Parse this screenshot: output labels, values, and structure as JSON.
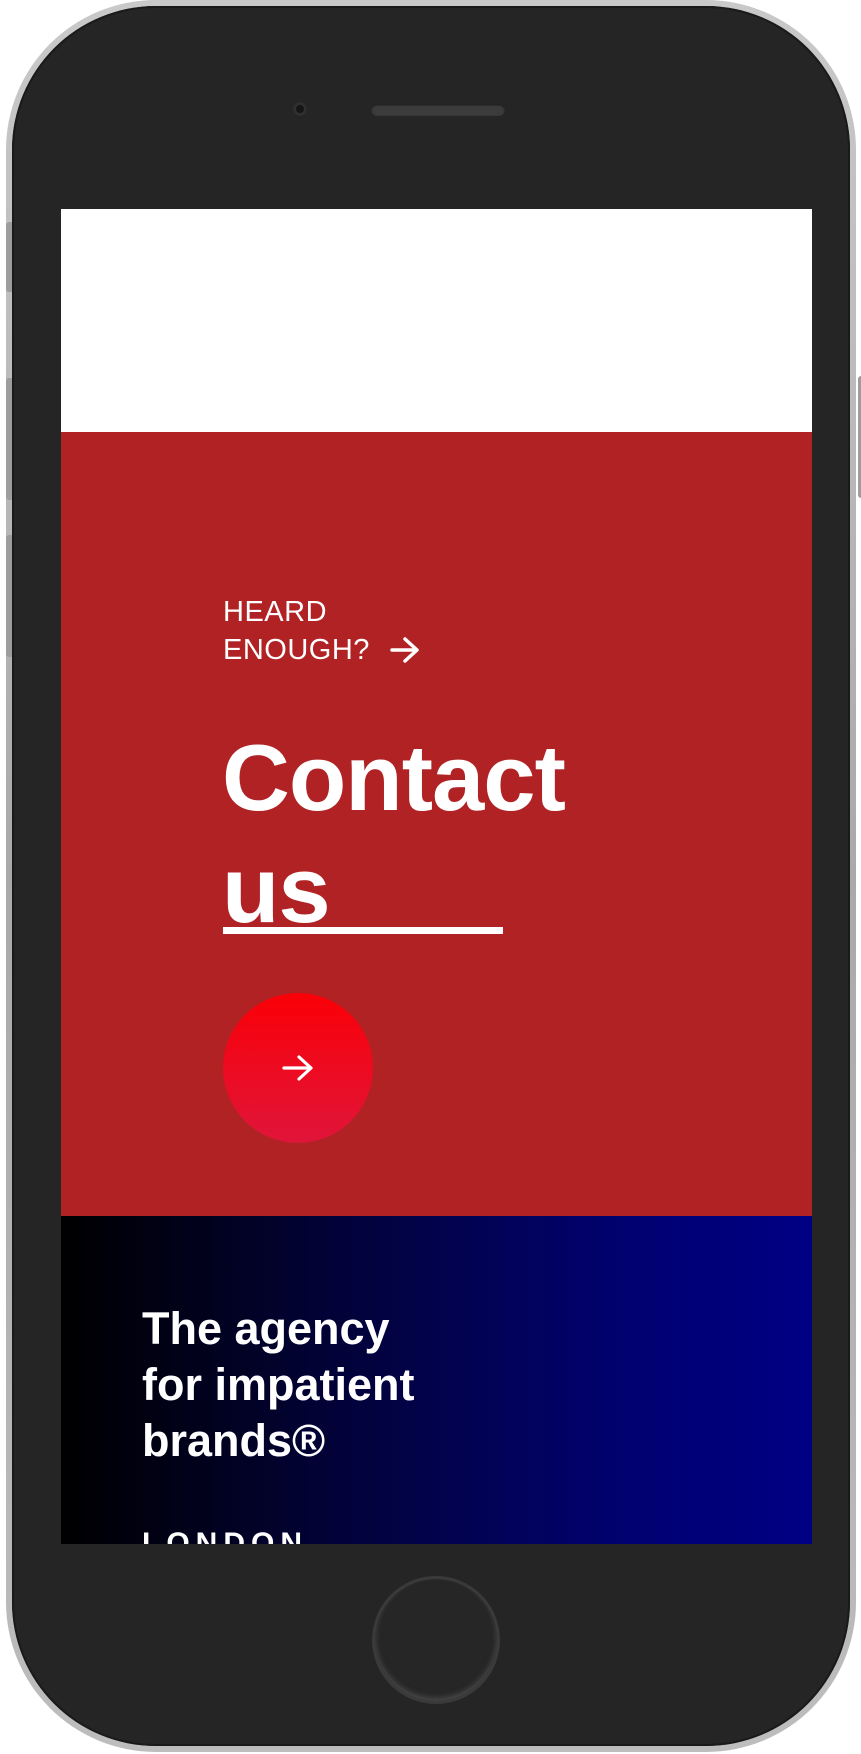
{
  "contact": {
    "kicker_line1": "HEARD",
    "kicker_line2": "ENOUGH?",
    "title_line1": "Contact",
    "title_line2": "us",
    "arrow_icon": "arrow-right-icon",
    "background_color": "#b02224",
    "button_color": "#f5000f"
  },
  "footer": {
    "tagline_line1": "The agency",
    "tagline_line2": "for impatient",
    "tagline_line3": "brands®",
    "city": "LONDON"
  },
  "device": {
    "frame_color": "#252525"
  }
}
